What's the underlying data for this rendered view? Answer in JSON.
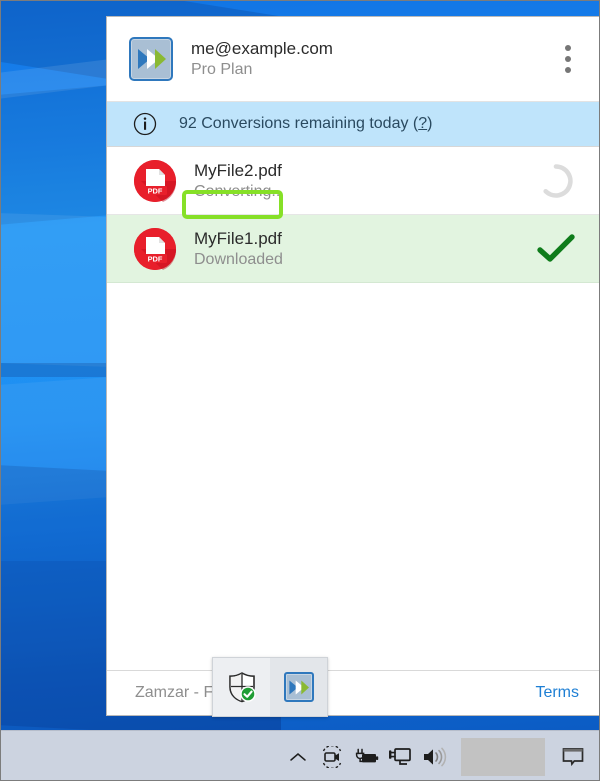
{
  "app": {
    "account": {
      "email": "me@example.com",
      "plan": "Pro Plan",
      "logo_icon": "zamzar-chevrons-icon",
      "overflow_icon": "more-vertical-icon"
    },
    "quota_banner": {
      "icon": "info-circle-icon",
      "text": "92 Conversions remaining today (",
      "help_label": "?",
      "text_close": ")",
      "count": 92,
      "background_color": "#bfe4fb"
    },
    "files": [
      {
        "name": "MyFile2.pdf",
        "status": "Converting..",
        "icon": "pdf-file-icon",
        "state_icon": "spinner-icon",
        "row_highlight": false
      },
      {
        "name": "MyFile1.pdf",
        "status": "Downloaded",
        "icon": "pdf-file-icon",
        "state_icon": "checkmark-icon",
        "row_highlight": true
      }
    ],
    "footer": {
      "brand": "Zamzar - F",
      "terms_label": "Terms",
      "terms_color": "#1e7fd4"
    }
  },
  "tray_flyout": {
    "items": [
      {
        "icon": "shield-check-icon",
        "label": ""
      },
      {
        "icon": "zamzar-chevrons-icon",
        "label": ""
      }
    ]
  },
  "taskbar": {
    "items": [
      {
        "icon": "chevron-up-icon"
      },
      {
        "icon": "webcam-icon"
      },
      {
        "icon": "battery-charging-icon"
      },
      {
        "icon": "network-display-icon"
      },
      {
        "icon": "volume-icon"
      }
    ],
    "clock": "",
    "action_center_icon": "speech-bubble-icon",
    "background_color": "#ccd3e0"
  },
  "annotation": {
    "target": "Converting..",
    "color": "#86e027"
  }
}
